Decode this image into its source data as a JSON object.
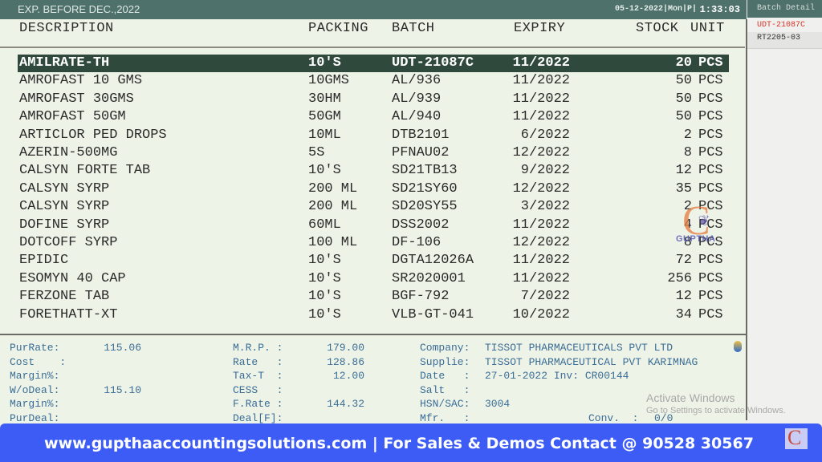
{
  "titlebar": {
    "title": "EXP. BEFORE DEC.,2022",
    "datetime": "05-12-2022|Mon|P|",
    "clock": "1:33:03"
  },
  "columns": {
    "description": "DESCRIPTION",
    "packing": "PACKING",
    "batch": "BATCH",
    "expiry": "EXPIRY",
    "stock": "STOCK",
    "unit": "UNIT"
  },
  "rows": [
    {
      "desc": "AMILRATE-TH",
      "pack": "10'S",
      "batch": "UDT-21087C",
      "exp": "11/2022",
      "stock": "20",
      "unit": "PCS",
      "selected": true
    },
    {
      "desc": "AMROFAST 10 GMS",
      "pack": "10GMS",
      "batch": "AL/936",
      "exp": "11/2022",
      "stock": "50",
      "unit": "PCS"
    },
    {
      "desc": "AMROFAST 30GMS",
      "pack": "30HM",
      "batch": "AL/939",
      "exp": "11/2022",
      "stock": "50",
      "unit": "PCS"
    },
    {
      "desc": "AMROFAST 50GM",
      "pack": "50GM",
      "batch": "AL/940",
      "exp": "11/2022",
      "stock": "50",
      "unit": "PCS"
    },
    {
      "desc": "ARTICLOR PED DROPS",
      "pack": "10ML",
      "batch": "DTB2101",
      "exp": "6/2022",
      "stock": "2",
      "unit": "PCS"
    },
    {
      "desc": "AZERIN-500MG",
      "pack": "5S",
      "batch": "PFNAU02",
      "exp": "12/2022",
      "stock": "8",
      "unit": "PCS"
    },
    {
      "desc": "CALSYN FORTE TAB",
      "pack": "10'S",
      "batch": "SD21TB13",
      "exp": "9/2022",
      "stock": "12",
      "unit": "PCS"
    },
    {
      "desc": "CALSYN SYRP",
      "pack": "200 ML",
      "batch": "SD21SY60",
      "exp": "12/2022",
      "stock": "35",
      "unit": "PCS"
    },
    {
      "desc": "CALSYN SYRP",
      "pack": "200 ML",
      "batch": "SD20SY55",
      "exp": "3/2022",
      "stock": "2",
      "unit": "PCS"
    },
    {
      "desc": "DOFINE SYRP",
      "pack": "60ML",
      "batch": "DSS2002",
      "exp": "11/2022",
      "stock": "4",
      "unit": "PCS"
    },
    {
      "desc": "DOTCOFF SYRP",
      "pack": "100 ML",
      "batch": "DF-106",
      "exp": "12/2022",
      "stock": "8",
      "unit": "PCS"
    },
    {
      "desc": "EPIDIC",
      "pack": "10'S",
      "batch": "DGTA12026A",
      "exp": "11/2022",
      "stock": "72",
      "unit": "PCS"
    },
    {
      "desc": "ESOMYN 40 CAP",
      "pack": "10'S",
      "batch": "SR2020001",
      "exp": "11/2022",
      "stock": "256",
      "unit": "PCS"
    },
    {
      "desc": "FERZONE TAB",
      "pack": "10'S",
      "batch": "BGF-792",
      "exp": "7/2022",
      "stock": "12",
      "unit": "PCS"
    },
    {
      "desc": "FORETHATT-XT",
      "pack": "10'S",
      "batch": "VLB-GT-041",
      "exp": "10/2022",
      "stock": "34",
      "unit": "PCS"
    }
  ],
  "details": {
    "col1": [
      {
        "label": "PurRate:",
        "value": "115.06"
      },
      {
        "label": "Cost    :",
        "value": ""
      },
      {
        "label": "Margin%:",
        "value": ""
      },
      {
        "label": "W/oDeal:",
        "value": "115.10"
      },
      {
        "label": "Margin%:",
        "value": ""
      },
      {
        "label": "PurDeal:",
        "value": ""
      }
    ],
    "col2": [
      {
        "label": "M.R.P. :",
        "value": "179.00"
      },
      {
        "label": "Rate   :",
        "value": "128.86"
      },
      {
        "label": "Tax-T  :",
        "value": "12.00"
      },
      {
        "label": "CESS   :",
        "value": ""
      },
      {
        "label": "F.Rate :",
        "value": "144.32"
      },
      {
        "label": "Deal[F]:",
        "value": ""
      }
    ],
    "col3": [
      {
        "label": "Company:",
        "value": "TISSOT PHARMACEUTICALS PVT LTD"
      },
      {
        "label": "Supplie:",
        "value": "TISSOT PHARMACEUTICAL PVT KARIMNAG"
      },
      {
        "label": "Date   :",
        "value": "27-01-2022 Inv: CR00144"
      },
      {
        "label": "Salt   :",
        "value": ""
      },
      {
        "label": "HSN/SAC:",
        "value": "3004"
      },
      {
        "label": "Mfr.   :",
        "value": ""
      }
    ],
    "conv": {
      "label": "Conv.  :",
      "value": "0/0"
    }
  },
  "batch_panel": {
    "title": "Batch Detail",
    "items": [
      "UDT-21087C",
      "RT2205-03"
    ]
  },
  "watermark": {
    "logo_letter": "C",
    "logo_text": "GUPTHA"
  },
  "activate_windows": {
    "line1": "Activate Windows",
    "line2": "Go to Settings to activate Windows."
  },
  "banner": {
    "text": "www.gupthaaccountingsolutions.com | For Sales & Demos Contact @ 90528 30567",
    "logo_letter": "C",
    "color": "#3d5cf5"
  }
}
